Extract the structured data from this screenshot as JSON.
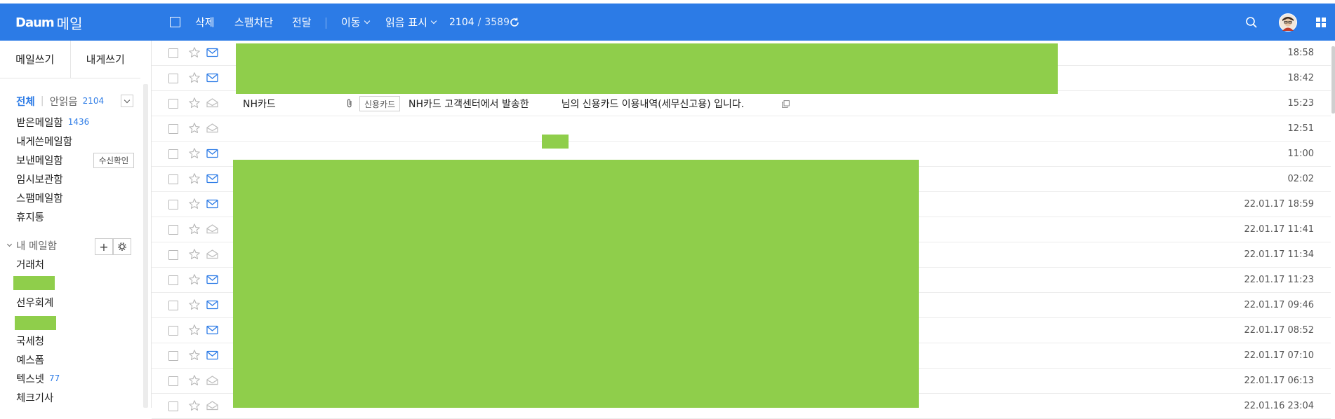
{
  "app": {
    "logo_mark": "Daum",
    "logo_text": "메일"
  },
  "toolbar": {
    "delete_label": "삭제",
    "spam_label": "스팸차단",
    "forward_label": "전달",
    "move_label": "이동",
    "read_mark_label": "읽음 표시",
    "unread_count": "2104",
    "count_sep": "/",
    "total_count": "3589",
    "refresh_icon": "refresh-icon",
    "search_icon": "search-icon",
    "apps_icon": "grid-icon"
  },
  "colors": {
    "brand": "#2c7be6",
    "redaction": "#8fce4b",
    "count_blue": "#2c7be6"
  },
  "sidebar": {
    "compose_label": "메일쓰기",
    "self_compose_label": "내게쓰기",
    "filter": {
      "all_label": "전체",
      "unread_label": "안읽음",
      "unread_count": "2104"
    },
    "folders": [
      {
        "label": "받은메일함",
        "count": "1436"
      },
      {
        "label": "내게쓴메일함",
        "count": ""
      },
      {
        "label": "보낸메일함",
        "count": ""
      },
      {
        "label": "임시보관함",
        "count": ""
      },
      {
        "label": "스팸메일함",
        "count": ""
      },
      {
        "label": "휴지통",
        "count": ""
      }
    ],
    "read_receipt_label": "수신확인",
    "my_folders_label": "내 메일함",
    "my_folders": [
      {
        "label": "거래처",
        "count": ""
      },
      {
        "label": "선우회계",
        "count": ""
      },
      {
        "label": "국세청",
        "count": ""
      },
      {
        "label": "예스폼",
        "count": ""
      },
      {
        "label": "텍스넷",
        "count": "77"
      },
      {
        "label": "체크기사",
        "count": ""
      }
    ]
  },
  "mail_list": {
    "rows": [
      {
        "time": "18:58",
        "read": false
      },
      {
        "time": "18:42",
        "read": false
      },
      {
        "time": "15:23",
        "read": true,
        "sender": "NH카드",
        "tag": "신용카드",
        "subject_pre": "NH카드 고객센터에서 발송한",
        "subject_post": "님의 신용카드 이용내역(세무신고용) 입니다."
      },
      {
        "time": "12:51",
        "read": true
      },
      {
        "time": "11:00",
        "read": false
      },
      {
        "time": "02:02",
        "read": false
      },
      {
        "time": "22.01.17 18:59",
        "read": false
      },
      {
        "time": "22.01.17 11:41",
        "read": true
      },
      {
        "time": "22.01.17 11:34",
        "read": true
      },
      {
        "time": "22.01.17 11:23",
        "read": false
      },
      {
        "time": "22.01.17 09:46",
        "read": false
      },
      {
        "time": "22.01.17 08:52",
        "read": false
      },
      {
        "time": "22.01.17 07:10",
        "read": false
      },
      {
        "time": "22.01.17 06:13",
        "read": true
      },
      {
        "time": "22.01.16 23:04",
        "read": true
      }
    ]
  }
}
